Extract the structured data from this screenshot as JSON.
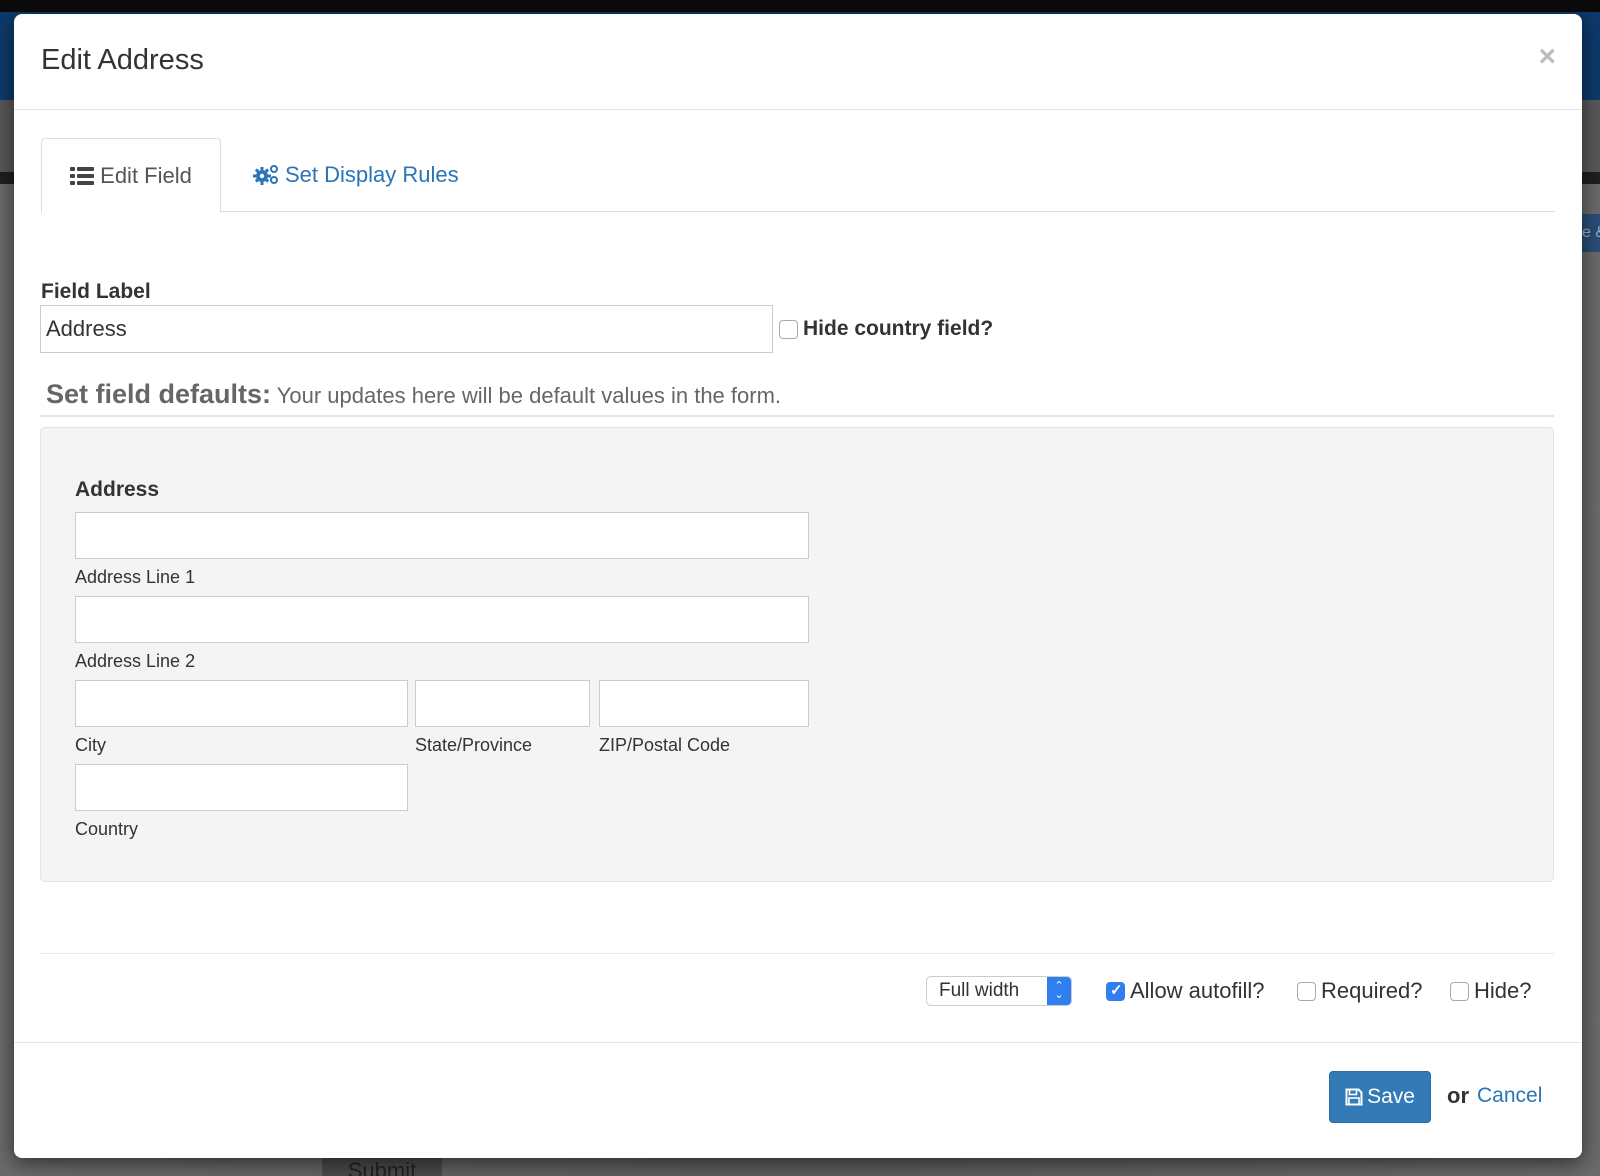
{
  "modal": {
    "title": "Edit Address",
    "close_symbol": "×"
  },
  "tabs": [
    {
      "label": "Edit Field",
      "icon": "list-icon",
      "active": true
    },
    {
      "label": "Set Display Rules",
      "icon": "gears-icon",
      "active": false
    }
  ],
  "field_label": {
    "heading": "Field Label",
    "value": "Address",
    "hide_country_label": "Hide country field?",
    "hide_country_checked": false
  },
  "defaults": {
    "heading_bold": "Set field defaults:",
    "heading_rest": " Your updates here will be default values in the form.",
    "address_heading": "Address",
    "fields": {
      "line1": {
        "label": "Address Line 1",
        "value": ""
      },
      "line2": {
        "label": "Address Line 2",
        "value": ""
      },
      "city": {
        "label": "City",
        "value": ""
      },
      "state": {
        "label": "State/Province",
        "value": ""
      },
      "zip": {
        "label": "ZIP/Postal Code",
        "value": ""
      },
      "country": {
        "label": "Country",
        "value": ""
      }
    }
  },
  "options": {
    "width_select": "Full width",
    "allow_autofill": {
      "label": "Allow autofill?",
      "checked": true
    },
    "required": {
      "label": "Required?",
      "checked": false
    },
    "hide": {
      "label": "Hide?",
      "checked": false
    }
  },
  "footer": {
    "save_label": "Save",
    "or_text": "or",
    "cancel_label": "Cancel"
  },
  "background": {
    "submit_label": "Submit",
    "right_tab_fragment": "e &"
  },
  "colors": {
    "primary": "#337ab7",
    "link": "#2a74b9",
    "checkbox_checked": "#2f7ff0"
  }
}
